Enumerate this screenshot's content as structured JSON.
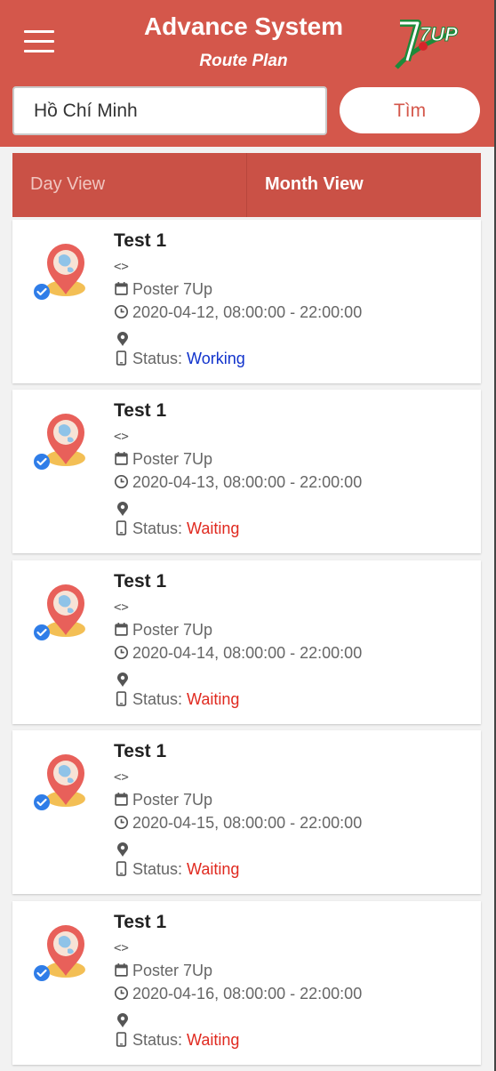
{
  "header": {
    "title": "Advance System",
    "subtitle": "Route Plan",
    "logo_text": "7UP"
  },
  "search": {
    "value": "Hồ Chí Minh",
    "button_label": "Tìm"
  },
  "tabs": {
    "day": "Day View",
    "month": "Month View",
    "active": "month"
  },
  "status_label": "Status:",
  "colors": {
    "header": "#d4574b",
    "tabs": "#ca5146",
    "working": "#1133cc",
    "waiting": "#e02a20"
  },
  "cards": [
    {
      "title": "Test 1",
      "code": "<>",
      "poster": "Poster 7Up",
      "time": "2020-04-12, 08:00:00 - 22:00:00",
      "status": "Working"
    },
    {
      "title": "Test 1",
      "code": "<>",
      "poster": "Poster 7Up",
      "time": "2020-04-13, 08:00:00 - 22:00:00",
      "status": "Waiting"
    },
    {
      "title": "Test 1",
      "code": "<>",
      "poster": "Poster 7Up",
      "time": "2020-04-14, 08:00:00 - 22:00:00",
      "status": "Waiting"
    },
    {
      "title": "Test 1",
      "code": "<>",
      "poster": "Poster 7Up",
      "time": "2020-04-15, 08:00:00 - 22:00:00",
      "status": "Waiting"
    },
    {
      "title": "Test 1",
      "code": "<>",
      "poster": "Poster 7Up",
      "time": "2020-04-16, 08:00:00 - 22:00:00",
      "status": "Waiting"
    }
  ]
}
